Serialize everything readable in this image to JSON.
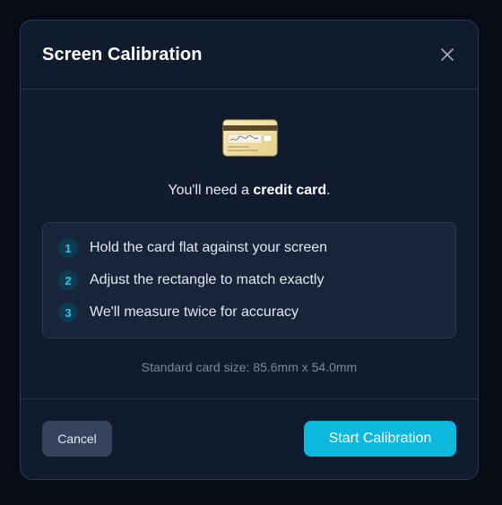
{
  "dialog": {
    "title": "Screen Calibration",
    "close_icon": "close-icon"
  },
  "intro": {
    "prefix": "You'll need a ",
    "highlight": "credit card",
    "suffix": ".",
    "illustration_icon": "credit-card-icon",
    "card_text_line1": "Authorized Signature",
    "card_signature": "John Appleseed"
  },
  "steps": [
    {
      "number": "1",
      "text": "Hold the card flat against your screen"
    },
    {
      "number": "2",
      "text": "Adjust the rectangle to match exactly"
    },
    {
      "number": "3",
      "text": "We'll measure twice for accuracy"
    }
  ],
  "note": "Standard card size: 85.6mm x 54.0mm",
  "footer": {
    "cancel_label": "Cancel",
    "start_label": "Start Calibration"
  },
  "colors": {
    "accent": "#0cb8de",
    "modal_bg": "#111b2e",
    "panel_bg": "#17243a"
  }
}
